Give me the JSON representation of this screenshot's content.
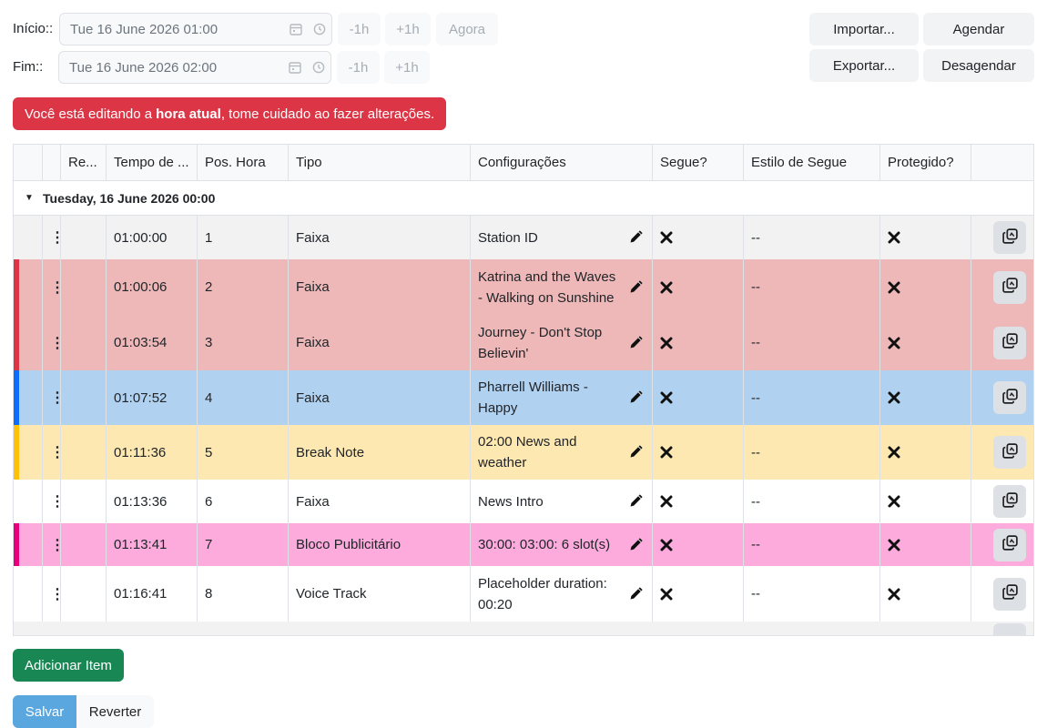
{
  "controls": {
    "start_label": "Início::",
    "end_label": "Fim::",
    "start_value": "Tue 16 June 2026 01:00",
    "end_value": "Tue 16 June 2026 02:00",
    "minus_1h": "-1h",
    "plus_1h": "+1h",
    "now": "Agora",
    "import": "Importar...",
    "schedule": "Agendar",
    "export": "Exportar...",
    "unschedule": "Desagendar"
  },
  "alert": {
    "prefix": "Você está editando a",
    "bold": "hora atual",
    "suffix": ", tome cuidado ao fazer alterações."
  },
  "table": {
    "headers": [
      "Re...",
      "Tempo de ...",
      "Pos. Hora",
      "Tipo",
      "Configurações",
      "Segue?",
      "Estilo de Segue",
      "Protegido?"
    ],
    "group_title": "Tuesday, 16 June 2026 00:00",
    "rows": [
      {
        "time": "01:00:00",
        "pos": "1",
        "type": "Faixa",
        "config": "Station ID",
        "follow_style": "--"
      },
      {
        "time": "01:00:06",
        "pos": "2",
        "type": "Faixa",
        "config": "Katrina and the Waves - Walking on Sunshine",
        "follow_style": "--"
      },
      {
        "time": "01:03:54",
        "pos": "3",
        "type": "Faixa",
        "config": "Journey - Don't Stop Believin'",
        "follow_style": "--"
      },
      {
        "time": "01:07:52",
        "pos": "4",
        "type": "Faixa",
        "config": "Pharrell Williams - Happy",
        "follow_style": "--"
      },
      {
        "time": "01:11:36",
        "pos": "5",
        "type": "Break Note",
        "config": "02:00 News and weather",
        "follow_style": "--"
      },
      {
        "time": "01:13:36",
        "pos": "6",
        "type": "Faixa",
        "config": "News Intro",
        "follow_style": "--"
      },
      {
        "time": "01:13:41",
        "pos": "7",
        "type": "Bloco Publicitário",
        "config": "30:00: 03:00: 6 slot(s)",
        "follow_style": "--"
      },
      {
        "time": "01:16:41",
        "pos": "8",
        "type": "Voice Track",
        "config": "Placeholder duration: 00:20",
        "follow_style": "--"
      }
    ]
  },
  "colors": {
    "alert_red": "#dc3545",
    "row_red": "#eeb8b8",
    "row_blue": "#b1d1f0",
    "row_yellow": "#fde8b2",
    "row_pink": "#fdaadc",
    "stripe_red": "#dc3545",
    "stripe_blue": "#0d6efd",
    "stripe_yellow": "#ffc107",
    "stripe_pink": "#e6007e"
  },
  "footer": {
    "add_item": "Adicionar Item",
    "save": "Salvar",
    "revert": "Reverter"
  }
}
